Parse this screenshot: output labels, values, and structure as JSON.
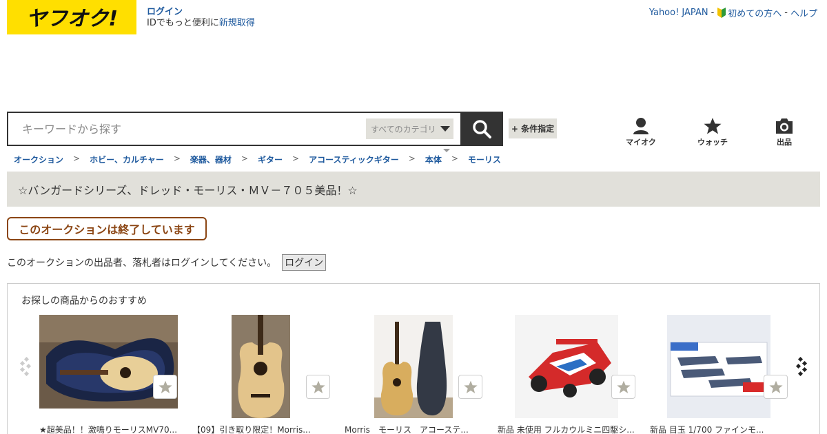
{
  "brand": {
    "logo_text": "ヤフオク!",
    "color": "#ffdf00"
  },
  "header": {
    "login_label": "ログイン",
    "login_sub_prefix": "IDでもっと便利に",
    "signup_label": "新規取得",
    "links": [
      {
        "label": "Yahoo! JAPAN"
      },
      {
        "label": "初めての方へ"
      },
      {
        "label": "ヘルプ"
      }
    ],
    "separator": "-"
  },
  "search": {
    "placeholder": "キーワードから探す",
    "category_label": "すべてのカテゴリ",
    "condition_label": "+ 条件指定"
  },
  "nav_icons": [
    {
      "label": "マイオク",
      "icon": "person-icon"
    },
    {
      "label": "ウォッチ",
      "icon": "star-icon"
    },
    {
      "label": "出品",
      "icon": "camera-icon"
    }
  ],
  "breadcrumb": [
    "オークション",
    "ホビー、カルチャー",
    "楽器、器材",
    "ギター",
    "アコースティックギター",
    "本体",
    "モーリス"
  ],
  "breadcrumb_arrow": ">",
  "auction": {
    "title": "☆バンガードシリーズ、ドレッド・モーリス・ＭＶ－７０５美品！☆",
    "ended_label": "このオークションは終了しています",
    "login_notice": "このオークションの出品者、落札者はログインしてください。",
    "login_button": "ログイン"
  },
  "recommend": {
    "title": "お探しの商品からのおすすめ",
    "items": [
      {
        "name": "★超美品！！激鳴りモーリスMV70..."
      },
      {
        "name": "【09】引き取り限定！Morris..."
      },
      {
        "name": "Morris　モーリス　アコーステ..."
      },
      {
        "name": "新品 未使用 フルカウルミニ四駆シ..."
      },
      {
        "name": "新品 目玉 1/700 ファインモ..."
      }
    ]
  }
}
